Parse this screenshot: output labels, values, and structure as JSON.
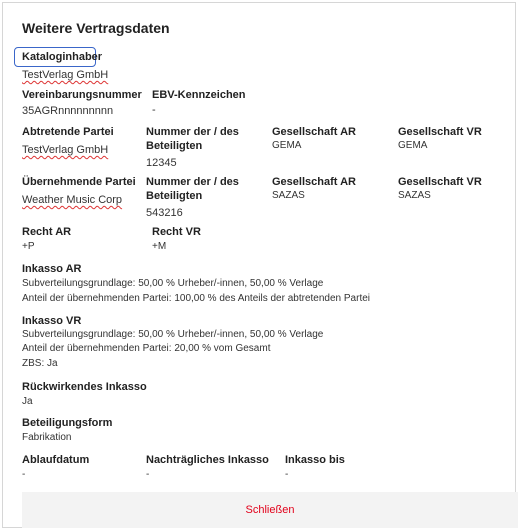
{
  "dialog": {
    "title": "Weitere Vertragsdaten",
    "close_label": "Schließen"
  },
  "kataloginhaber": {
    "label": "Kataloginhaber",
    "value": "TestVerlag GmbH"
  },
  "vereinbarung": {
    "label": "Vereinbarungsnummer",
    "value": "35AGRnnnnnnnnn",
    "ebv_label": "EBV-Kennzeichen",
    "ebv_value": "-"
  },
  "abtretende": {
    "label": "Abtretende Partei",
    "value": "TestVerlag GmbH",
    "nummer_label_1": "Nummer der / des",
    "nummer_label_2": "Beteiligten",
    "nummer_value": "12345",
    "gesellschaft_ar_label": "Gesellschaft AR",
    "gesellschaft_ar_value": "GEMA",
    "gesellschaft_vr_label": "Gesellschaft VR",
    "gesellschaft_vr_value": "GEMA"
  },
  "uebernehmende": {
    "label": "Übernehmende Partei",
    "value": "Weather Music Corp",
    "nummer_label_1": "Nummer der / des",
    "nummer_label_2": "Beteiligten",
    "nummer_value": "543216",
    "gesellschaft_ar_label": "Gesellschaft AR",
    "gesellschaft_ar_value": "SAZAS",
    "gesellschaft_vr_label": "Gesellschaft VR",
    "gesellschaft_vr_value": "SAZAS"
  },
  "recht": {
    "ar_label": "Recht AR",
    "ar_value": "+P",
    "vr_label": "Recht VR",
    "vr_value": "+M"
  },
  "inkasso_ar": {
    "label": "Inkasso AR",
    "line1": "Subverteilungsgrundlage: 50,00 % Urheber/-innen, 50,00 % Verlage",
    "line2": "Anteil der übernehmenden Partei: 100,00 % des Anteils der abtretenden Partei"
  },
  "inkasso_vr": {
    "label": "Inkasso VR",
    "line1": "Subverteilungsgrundlage: 50,00 % Urheber/-innen, 50,00 % Verlage",
    "line2": "Anteil der übernehmenden Partei: 20,00 % vom Gesamt",
    "line3": "ZBS: Ja"
  },
  "rueckwirkend": {
    "label": "Rückwirkendes Inkasso",
    "value": "Ja"
  },
  "beteiligungsform": {
    "label": "Beteiligungsform",
    "value": "Fabrikation"
  },
  "ablauf": {
    "ablaufdatum_label": "Ablaufdatum",
    "ablaufdatum_value": "-",
    "nachtraeglich_label": "Nachträgliches Inkasso",
    "nachtraeglich_value": "-",
    "inkasso_bis_label": "Inkasso bis",
    "inkasso_bis_value": "-"
  }
}
